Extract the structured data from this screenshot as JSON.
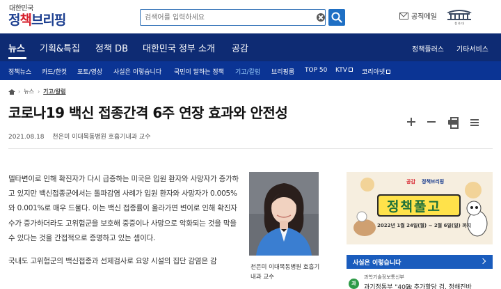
{
  "header": {
    "logo_small": "대한민국",
    "logo_part1": "정",
    "logo_part2": "책",
    "logo_part3": "브리핑",
    "search_placeholder": "검색어를 입력하세요",
    "mail_label": "공직메일",
    "bluehouse_label": "청 와 대"
  },
  "main_nav": {
    "items": [
      "뉴스",
      "기획&특집",
      "정책 DB",
      "대한민국 정부 소개",
      "공감"
    ],
    "right": [
      "정책플러스",
      "기타서비스"
    ]
  },
  "sub_nav": {
    "items": [
      "정책뉴스",
      "카드/한컷",
      "포토/영상",
      "사실은 이렇습니다",
      "국민이 말하는 정책",
      "기고/칼럼",
      "브리핑룸",
      "TOP 50",
      "KTV",
      "코리아넷"
    ]
  },
  "breadcrumb": [
    "뉴스",
    "기고/칼럼"
  ],
  "article": {
    "title": "코로나19 백신 접종간격 6주 연장 효과와 안전성",
    "date": "2021.08.18",
    "author": "천은미 이대목동병원 호흡기내과 교수",
    "paragraph1": "델타변이로 인해 확진자가 다시 급증하는 미국은 입원 환자와 사망자가 증가하고 있지만 백신접종군에서는 돌파감염 사례가 입원 환자와 사망자가 0.005%와 0.001%로 매우 드물다. 이는 백신 접종률이 올라가면 변이로 인해 확진자 수가 증가하더라도 고위험군을 보호해 중증이나 사망으로 악화되는 것을 막을 수 있다는 것을 간접적으로 증명하고 있는 셈이다.",
    "paragraph2": "국내도 고위험군의 백신접종과 선제검사로 요양 시설의 집단 감염은 감",
    "photo_caption": "천은미 이대목동병원 호흡기내과 교수"
  },
  "sidebar": {
    "banner_title": "정책풀고",
    "banner_brand_left": "공감",
    "banner_brand_right": "정책브리핑",
    "banner_date": "2022년 1월 24일(월) ~ 2월 6일(일) 까지",
    "facts_title": "사실은 이렇습니다",
    "fact_badge": "과",
    "fact_source": "과학기술정보통신부",
    "fact_headline": "과기정통부 \"40㎓ 추가할당 검, 정해진바"
  },
  "colors": {
    "nav_main": "#0e2b73",
    "nav_sub": "#0b3494",
    "accent": "#1e6fc4",
    "facts_bar": "#1a5cbd"
  }
}
